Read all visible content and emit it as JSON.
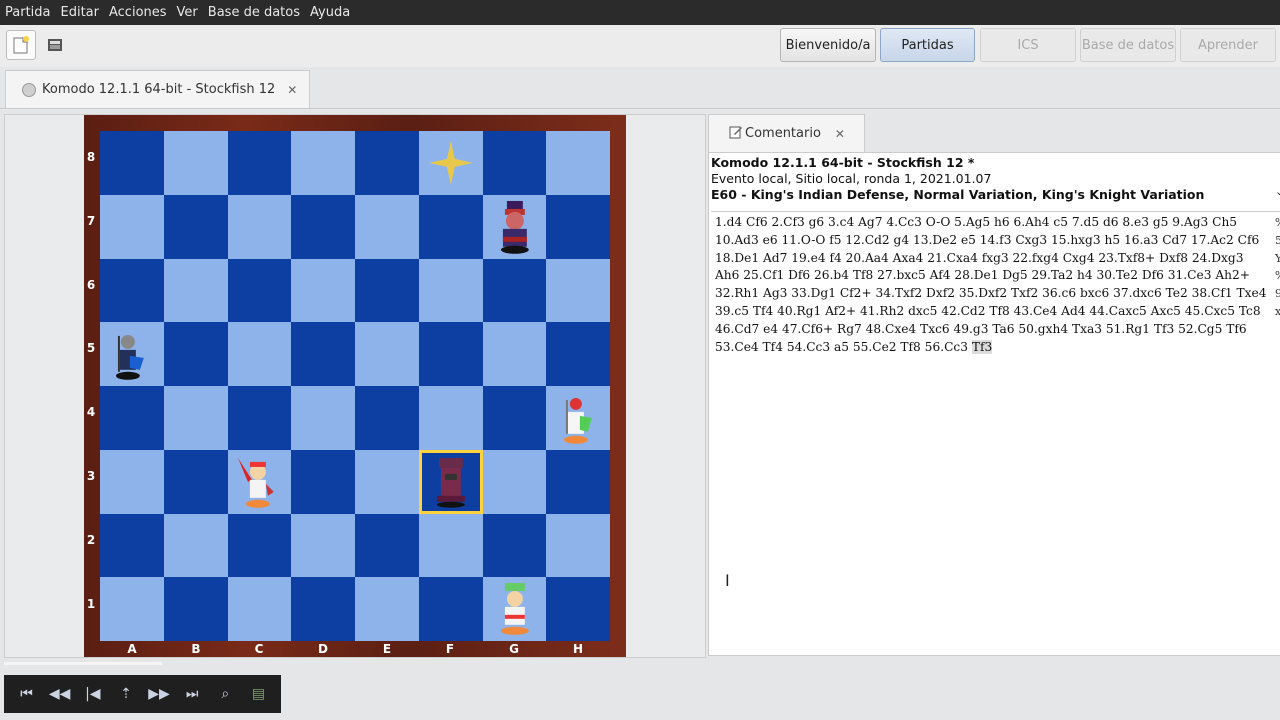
{
  "menu": [
    "Partida",
    "Editar",
    "Acciones",
    "Ver",
    "Base de datos",
    "Ayuda"
  ],
  "toolbar": {
    "buttons": [
      "Bienvenido/a",
      "Partidas",
      "ICS",
      "Base de datos",
      "Aprender"
    ],
    "overflow": "Y"
  },
  "game_tab": {
    "title": "Komodo 12.1.1 64-bit - Stockfish 12",
    "close": "✕"
  },
  "comment_tab": {
    "title": "Comentario",
    "close": "✕"
  },
  "game_header": {
    "players": "Komodo 12.1.1 64-bit - Stockfish 12 *",
    "event": "Evento local, Sitio local, ronda 1, 2021.01.07",
    "opening": "E60 - King's Indian Defense, Normal Variation, King's Knight Variation"
  },
  "moves_text": "1.d4 Cf6 2.Cf3 g6 3.c4 Ag7 4.Cc3 O-O 5.Ag5 h6 6.Ah4 c5 7.d5 d6 8.e3 g5 9.Ag3 Ch5 10.Ad3 e6 11.O-O f5 12.Cd2 g4 13.De2 e5 14.f3 Cxg3 15.hxg3 h5 16.a3 Cd7 17.Ac2 Cf6 18.De1 Ad7 19.e4 f4 20.Aa4 Axa4 21.Cxa4 fxg3 22.fxg4 Cxg4 23.Txf8+ Dxf8 24.Dxg3 Ah6 25.Cf1 Df6 26.b4 Tf8 27.bxc5 Af4 28.De1 Dg5 29.Ta2 h4 30.Te2 Df6 31.Ce3 Ah2+ 32.Rh1 Ag3 33.Dg1 Cf2+ 34.Txf2 Dxf2 35.Dxf2 Txf2 36.c6 bxc6 37.dxc6 Te2 38.Cf1 Txe4 39.c5 Tf4 40.Rg1 Af2+ 41.Rh2 dxc5 42.Cd2 Tf8 43.Ce4 Ad4 44.Caxc5 Axc5 45.Cxc5 Tc8 46.Cd7 e4 47.Cf6+ Rg7 48.Cxe4 Txc6 49.g3 Ta6 50.gxh4 Txa3 51.Rg1 Tf3 52.Cg5 Tf6 53.Ce4 Tf4 54.Cc3 a5 55.Ce2 Tf8 56.Cc3",
  "current_move": "Tf3",
  "moves_side_chars": [
    "%",
    "5",
    "Y",
    "%",
    "9",
    "x"
  ],
  "board": {
    "ranks": [
      "8",
      "7",
      "6",
      "5",
      "4",
      "3",
      "2",
      "1"
    ],
    "files": [
      "A",
      "B",
      "C",
      "D",
      "E",
      "F",
      "G",
      "H"
    ],
    "pieces": [
      {
        "square": "g7",
        "piece": "black-king"
      },
      {
        "square": "a5",
        "piece": "black-pawn"
      },
      {
        "square": "f3",
        "piece": "black-rook"
      },
      {
        "square": "h4",
        "piece": "white-pawn"
      },
      {
        "square": "c3",
        "piece": "white-knight"
      },
      {
        "square": "g1",
        "piece": "white-king"
      }
    ],
    "highlight_squares": [
      "f8",
      "f3"
    ],
    "colors": {
      "light": "#8eb3ea",
      "dark": "#0c3fa1",
      "frame": "#6b2516"
    }
  },
  "nav": [
    "first-icon",
    "back-icon",
    "prev-variation-icon",
    "up-icon",
    "forward-icon",
    "last-icon",
    "zoom-icon",
    "book-icon"
  ]
}
